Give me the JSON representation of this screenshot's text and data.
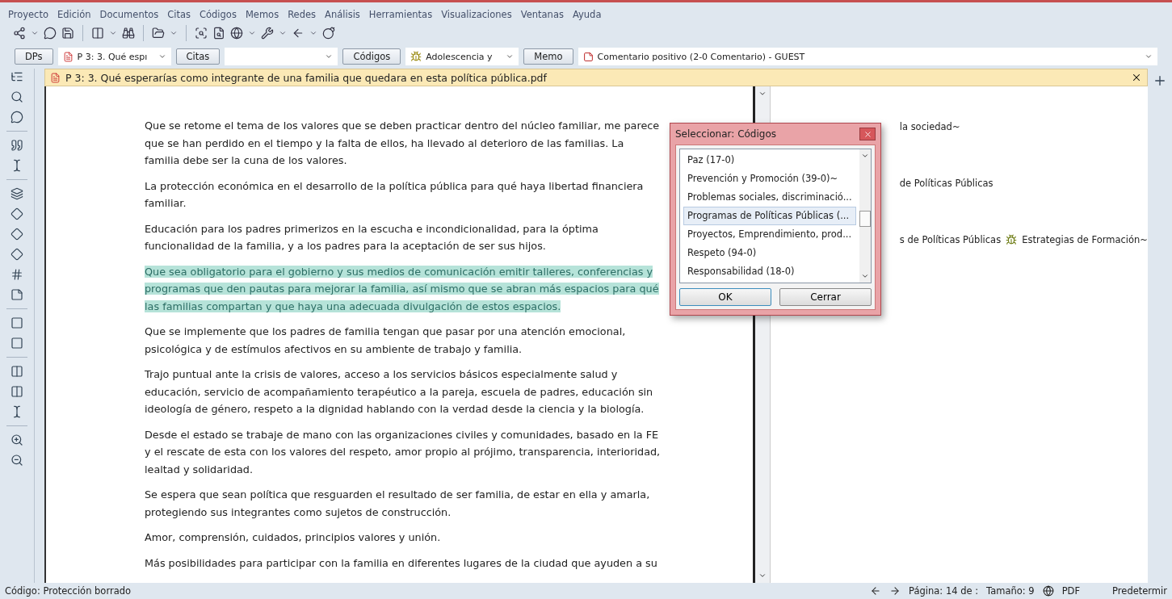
{
  "menu": [
    "Proyecto",
    "Edición",
    "Documentos",
    "Citas",
    "Códigos",
    "Memos",
    "Redes",
    "Análisis",
    "Herramientas",
    "Visualizaciones",
    "Ventanas",
    "Ayuda"
  ],
  "selector_bar": [
    {
      "kind": "button",
      "label": "DPs"
    },
    {
      "kind": "combo",
      "value": "P 3: 3. Qué espı"
    },
    {
      "kind": "button",
      "label": "Citas"
    },
    {
      "kind": "combo"
    },
    {
      "kind": "button",
      "label": "Códigos"
    },
    {
      "kind": "combo",
      "value": "Adolescencia y"
    },
    {
      "kind": "button",
      "label": "Memo"
    },
    {
      "kind": "combo",
      "value": "Comentario positivo (2-0 Comentario) - GUEST"
    }
  ],
  "document": {
    "title": "P 3:  3. Qué esperarías como integrante de una familia que quedara en esta política pública.pdf",
    "paragraphs": [
      {
        "kind": "plain",
        "text": "Que se retome el tema de los valores que se deben practicar dentro del núcleo familiar, me parece que se han perdido en el tiempo y la falta de ellos, ha llevado al deterioro de las familias. La familia debe ser la cuna de los valores."
      },
      {
        "kind": "plain",
        "text": "La protección económica en el desarrollo de la política pública para qué haya libertad financiera familiar."
      },
      {
        "kind": "plain",
        "text": "Educación para los padres primerizos en la escucha e incondicionalidad, para la óptima funcionalidad de la familia, y a los padres para la aceptación de ser sus hijos."
      },
      {
        "kind": "highlighted",
        "text": "Que sea obligatorio para el gobierno y sus medios de comunicación emitir talleres, conferencias y programas que den pautas para mejorar la familia, así mismo que se abran más espacios para qué las familias compartan y que haya una adecuada divulgación de estos espacios."
      },
      {
        "kind": "plain",
        "text": "Que se implemente que los padres de familia tengan que pasar por una atención emocional, psicológica y de estímulos afectivos en su ambiente de trabajo y familia."
      },
      {
        "kind": "plain",
        "text": "Trajo puntual ante la crisis de valores, acceso a los servicios básicos especialmente salud y educación, servicio de acompañamiento terapéutico a la pareja, escuela de padres, educación sin ideología de género, respeto a la dignidad hablando con la verdad desde la ciencia y la biología."
      },
      {
        "kind": "plain",
        "text": "Desde el estado se trabaje de mano con las organizaciones civiles y comunidades, basado en la FE y el rescate de esta con los valores del respeto, amor propio al prójimo, transparencia, interioridad, lealtad y solidaridad."
      },
      {
        "kind": "plain",
        "text": "Se espera que sean política que resguarden el resultado de ser familia, de estar en ella y amarla, protegiendo sus integrantes como sujetos de construcción."
      },
      {
        "kind": "plain",
        "text": "Amor, comprensión, cuidados, principios valores y unión."
      },
      {
        "kind": "plain",
        "text": "Más posibilidades para participar con la familia en diferentes lugares de la ciudad que ayuden a su"
      }
    ]
  },
  "margin_codes": [
    {
      "text": "la sociedad~"
    },
    {
      "text": "de Políticas Públicas"
    },
    {
      "text": "s de Políticas Públicas",
      "extra": "Estrategias de Formación~"
    }
  ],
  "dialog": {
    "title": "Seleccionar: Códigos",
    "items": [
      {
        "label": "Paz (17-0)",
        "selected": false
      },
      {
        "label": "Prevención y Promoción (39-0)~",
        "selected": false
      },
      {
        "label": "Problemas sociales, discriminació...",
        "selected": false
      },
      {
        "label": "Programas de Políticas Públicas (...",
        "selected": true
      },
      {
        "label": "Proyectos, Emprendimiento, prod...",
        "selected": false
      },
      {
        "label": "Respeto (94-0)",
        "selected": false
      },
      {
        "label": "Responsabilidad (18-0)",
        "selected": false
      }
    ],
    "buttons": [
      "OK",
      "Cerrar"
    ]
  },
  "status_bar": {
    "message": "Código: Protección borrado",
    "page": "Página: 14 de :",
    "size": "Tamaño: 9",
    "format": "PDF",
    "mode": "Predetermir"
  }
}
